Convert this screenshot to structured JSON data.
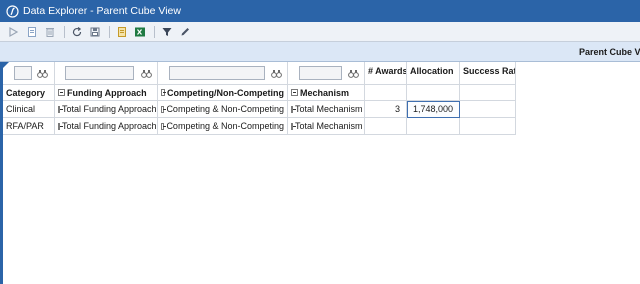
{
  "window": {
    "title": "Data Explorer - Parent Cube View"
  },
  "toolbar": {
    "buttons": [
      {
        "name": "navigate-icon"
      },
      {
        "name": "document-icon"
      },
      {
        "name": "delete-icon"
      },
      {
        "name": "refresh-icon"
      },
      {
        "name": "save-icon"
      },
      {
        "name": "report-icon"
      },
      {
        "name": "excel-icon"
      },
      {
        "name": "filter-icon"
      },
      {
        "name": "edit-pencil-icon"
      }
    ]
  },
  "header": {
    "view_title": "Parent Cube Vie"
  },
  "grid": {
    "columns": {
      "category": "Category",
      "funding": "Funding Approach",
      "competing": "Competing/Non-Competing",
      "mechanism": "Mechanism",
      "awards": "# Awards",
      "allocation": "Allocation",
      "success": "Success Rate"
    },
    "rows": [
      {
        "category": "Clinical",
        "funding": "Total Funding Approach",
        "competing": "Competing & Non-Competing",
        "mechanism": "Total Mechanism",
        "awards": "3",
        "allocation": "1,748,000",
        "success": ""
      },
      {
        "category": "RFA/PAR",
        "funding": "Total Funding Approach",
        "competing": "Competing & Non-Competing",
        "mechanism": "Total Mechanism",
        "awards": "",
        "allocation": "",
        "success": ""
      }
    ]
  },
  "colors": {
    "titlebar": "#2b64a8",
    "toolbar": "#eef2f7",
    "headerbar": "#dbe7f6"
  }
}
